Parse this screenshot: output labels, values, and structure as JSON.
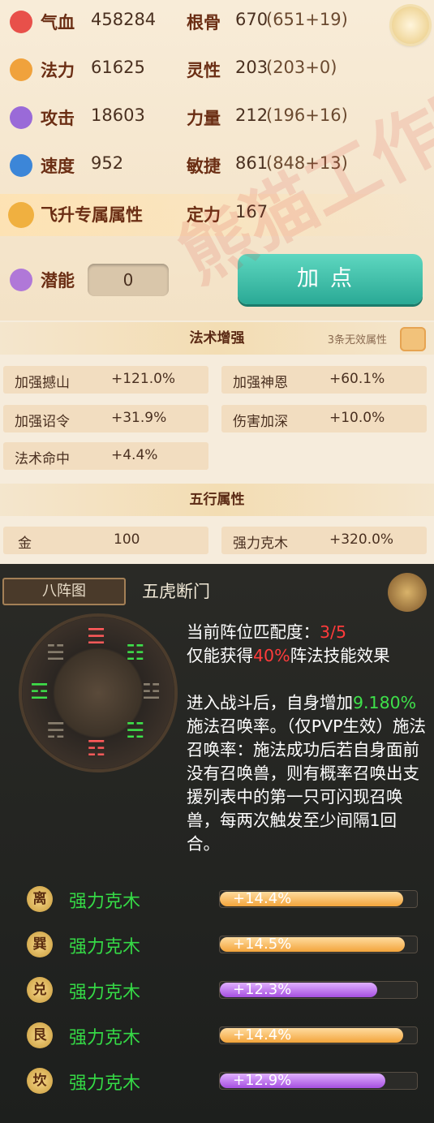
{
  "stats": {
    "rows": [
      {
        "label": "气血",
        "value": "458284",
        "label2": "根骨",
        "value2": "670",
        "extra2": "(651+19)",
        "icon": "blood-drop-icon",
        "icolor": "#e8504a"
      },
      {
        "label": "法力",
        "value": "61625",
        "label2": "灵性",
        "value2": "203",
        "extra2": "(203+0)",
        "icon": "swirl-icon",
        "icolor": "#f0a23c"
      },
      {
        "label": "攻击",
        "value": "18603",
        "label2": "力量",
        "value2": "212",
        "extra2": "(196+16)",
        "icon": "sword-icon",
        "icolor": "#9a6ad8"
      },
      {
        "label": "速度",
        "value": "952",
        "label2": "敏捷",
        "value2": "861",
        "extra2": "(848+13)",
        "icon": "boot-icon",
        "icolor": "#3c86d8"
      }
    ],
    "fly": {
      "label": "飞升专属属性",
      "label2": "定力",
      "value2": "167"
    },
    "potential": {
      "label": "潜能",
      "value": "0"
    },
    "add_button": "加点"
  },
  "magic": {
    "title": "法术增强",
    "invalid_note": "3条无效属性",
    "cells": [
      {
        "name": "加强撼山",
        "value": "+121.0%"
      },
      {
        "name": "加强神恩",
        "value": "+60.1%"
      },
      {
        "name": "加强诏令",
        "value": "+31.9%"
      },
      {
        "name": "伤害加深",
        "value": "+10.0%"
      },
      {
        "name": "法术命中",
        "value": "+4.4%"
      }
    ],
    "five_title": "五行属性",
    "five_cells": [
      {
        "name": "金",
        "value": "100"
      },
      {
        "name": "强力克木",
        "value": "+320.0%"
      }
    ]
  },
  "formation": {
    "tab": "八阵图",
    "name": "五虎断门",
    "match_label": "当前阵位匹配度：",
    "match_value": "3/5",
    "gain_prefix": "仅能获得",
    "gain_pct": "40%",
    "gain_suffix": "阵法技能效果",
    "effect_1": "进入战斗后，自身增加",
    "effect_pct": "9.180%",
    "effect_2": "施法召唤率。（仅PVP生效）施法召唤率：施法成功后若自身面前没有召唤兽，则有概率召唤出支援列表中的第一只可闪现召唤兽，每两次触发至少间隔1回合。",
    "trigrams": [
      "☰",
      "☷",
      "☳",
      "☵",
      "☶",
      "☴",
      "☲",
      "☱"
    ],
    "rows": [
      {
        "badge": "离",
        "name": "强力克木",
        "value": "+14.4%",
        "fill": 0.93,
        "color": "orange"
      },
      {
        "badge": "巽",
        "name": "强力克木",
        "value": "+14.5%",
        "fill": 0.94,
        "color": "orange"
      },
      {
        "badge": "兑",
        "name": "强力克木",
        "value": "+12.3%",
        "fill": 0.8,
        "color": "purple"
      },
      {
        "badge": "艮",
        "name": "强力克木",
        "value": "+14.4%",
        "fill": 0.93,
        "color": "orange"
      },
      {
        "badge": "坎",
        "name": "强力克木",
        "value": "+12.9%",
        "fill": 0.84,
        "color": "purple"
      }
    ]
  },
  "watermark": "熊猫工作室"
}
